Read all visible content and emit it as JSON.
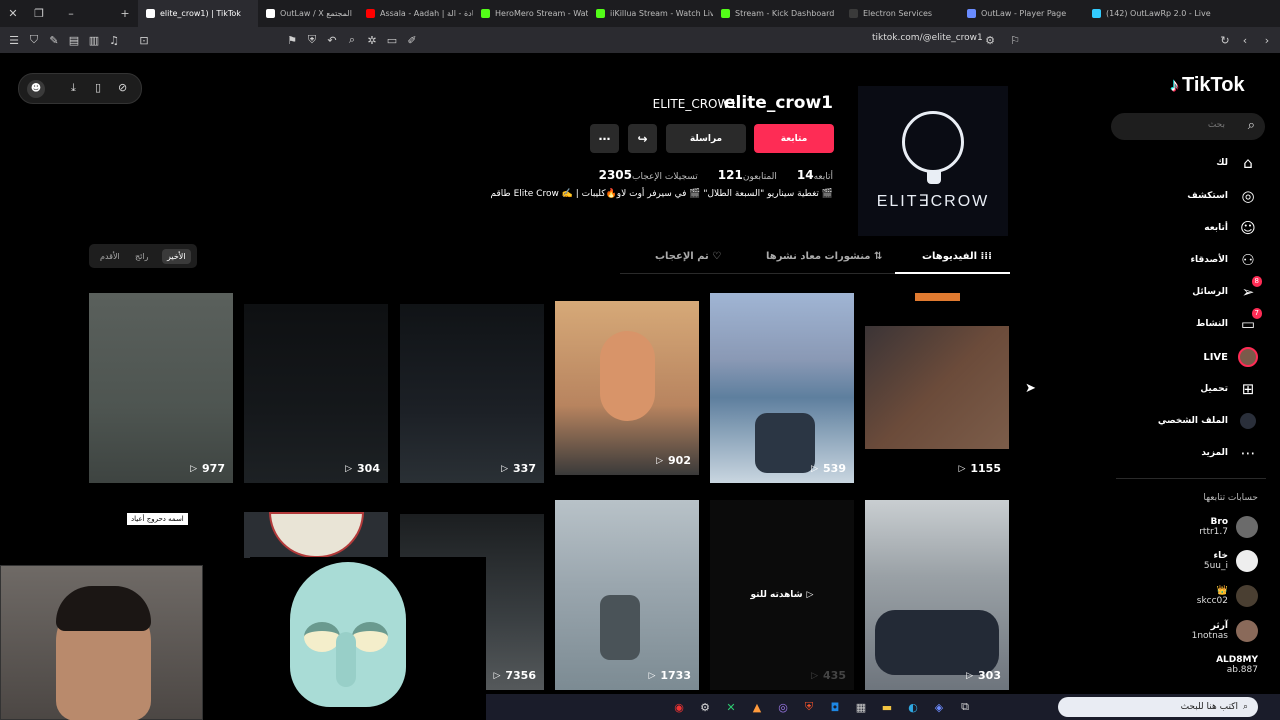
{
  "browser": {
    "tabs": [
      {
        "label": "elite_crow1) | TikTok",
        "active": true,
        "color": "#ffffff"
      },
      {
        "label": "OutLaw / X المجتمع",
        "active": false,
        "color": "#ffffff"
      },
      {
        "label": "Assala - Aadah | عادة - الة",
        "active": false,
        "color": "#ff0000"
      },
      {
        "label": "HeroMero Stream - Watch",
        "active": false,
        "color": "#53fc18"
      },
      {
        "label": "iiKillua Stream - Watch Liv",
        "active": false,
        "color": "#53fc18"
      },
      {
        "label": "Stream - Kick Dashboard",
        "active": false,
        "color": "#53fc18"
      },
      {
        "label": "Electron Services",
        "active": false,
        "color": "#3a3a3a"
      },
      {
        "label": "OutLaw - Player Page",
        "active": false,
        "color": "#6a8cff"
      },
      {
        "label": "(142) OutLawRp 2.0 - Live",
        "active": false,
        "color": "#33ccff"
      }
    ],
    "url": "tiktok.com/@elite_crow1"
  },
  "sidebar": {
    "logo": "TikTok",
    "search_placeholder": "بحث",
    "nav": [
      {
        "label": "لك",
        "icon": "home-icon",
        "glyph": "⌂"
      },
      {
        "label": "استكشف",
        "icon": "compass-icon",
        "glyph": "◎"
      },
      {
        "label": "أتابعه",
        "icon": "user-follow-icon",
        "glyph": "☺"
      },
      {
        "label": "الأصدقاء",
        "icon": "friends-icon",
        "glyph": "☺"
      },
      {
        "label": "الرسائل",
        "icon": "send-icon",
        "glyph": "➤",
        "badge": "8"
      },
      {
        "label": "النشاط",
        "icon": "activity-icon",
        "glyph": "✉",
        "badge": "7"
      },
      {
        "label": "LIVE",
        "icon": "live-icon",
        "glyph": "●"
      },
      {
        "label": "تحميل",
        "icon": "upload-icon",
        "glyph": "⊞"
      },
      {
        "label": "الملف الشخصي",
        "icon": "profile-icon",
        "glyph": "●"
      },
      {
        "label": "المزيد",
        "icon": "more-icon",
        "glyph": "⋯"
      }
    ],
    "following_title": "حسابات تتابعها",
    "following": [
      {
        "name": "Bro",
        "handle": "rttr1.7"
      },
      {
        "name": "خاء",
        "handle": "5uu_i"
      },
      {
        "name": "👑",
        "handle": "skcc02"
      },
      {
        "name": "آرثر",
        "handle": "1notnas"
      },
      {
        "name": "ALD8MY",
        "handle": "ab.887"
      }
    ]
  },
  "profile": {
    "username": "elite_crow1",
    "display_name": "ELITE_CROW1",
    "avatar_text": "ELIT∃CROW",
    "follow_label": "متابعة",
    "message_label": "مراسلة",
    "stats": [
      {
        "value": "14",
        "label": "أتابعه"
      },
      {
        "value": "121",
        "label": "المتابعون"
      },
      {
        "value": "2305",
        "label": "تسجيلات الإعجاب"
      }
    ],
    "bio": "طاقم Elite Crow ✍️ | تغطية سيناريو \"السبعة الطلال\" 🎬 في سيرفر أوت لاو🔥كليبات 🎬"
  },
  "tabs": {
    "videos": "الفيديوهات",
    "reposts": "منشورات معاد نشرها",
    "liked": "تم الإعجاب"
  },
  "sort": {
    "latest": "الأخير",
    "popular": "رائج",
    "oldest": "الأقدم"
  },
  "videos_row1": [
    {
      "views": "1155",
      "color": "#6b4b3a"
    },
    {
      "views": "539",
      "color": "#5e7f9e"
    },
    {
      "views": "902",
      "color": "#b8845f"
    },
    {
      "views": "337",
      "color": "#1c2026"
    },
    {
      "views": "304",
      "color": "#15181b"
    },
    {
      "views": "977",
      "color": "#4e5551"
    }
  ],
  "videos_row2": [
    {
      "views": "303",
      "color": "#6e757d"
    },
    {
      "views": "435",
      "color": "#0b0b0b"
    },
    {
      "views": "1733",
      "color": "#7c8b93"
    },
    {
      "views": "7356",
      "color": "#3a3f42"
    },
    {
      "views": "",
      "color": "#2b2f34"
    }
  ],
  "watch_again": "شاهدته للتو",
  "tooltip": "اسمه دحروج أعياد",
  "taskbar": {
    "search": "اكتب هنا للبحث"
  }
}
